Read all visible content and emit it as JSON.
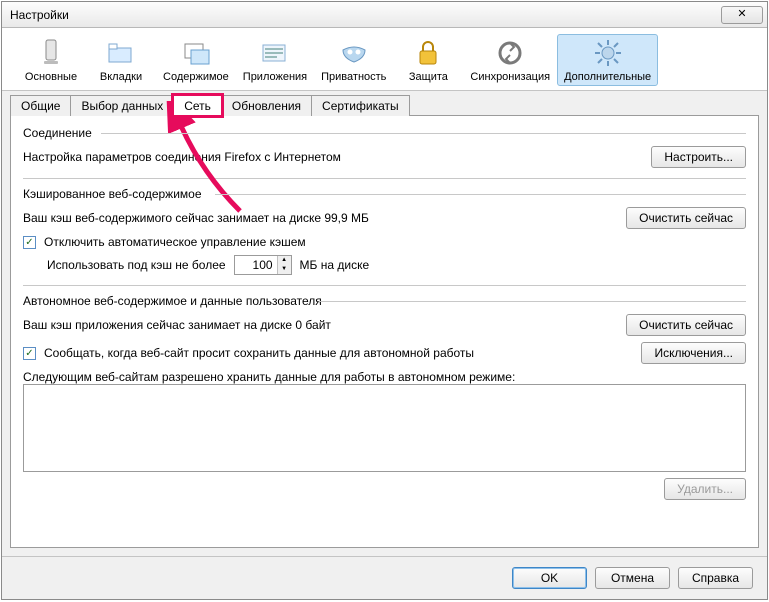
{
  "window": {
    "title": "Настройки"
  },
  "toolbar": [
    {
      "label": "Основные",
      "name": "general-icon"
    },
    {
      "label": "Вкладки",
      "name": "tabs-icon"
    },
    {
      "label": "Содержимое",
      "name": "content-icon"
    },
    {
      "label": "Приложения",
      "name": "applications-icon"
    },
    {
      "label": "Приватность",
      "name": "privacy-icon"
    },
    {
      "label": "Защита",
      "name": "security-icon"
    },
    {
      "label": "Синхронизация",
      "name": "sync-icon"
    },
    {
      "label": "Дополнительные",
      "name": "advanced-icon",
      "active": true
    }
  ],
  "tabs": [
    {
      "label": "Общие"
    },
    {
      "label": "Выбор данных"
    },
    {
      "label": "Сеть",
      "active": true,
      "highlight": true
    },
    {
      "label": "Обновления"
    },
    {
      "label": "Сертификаты"
    }
  ],
  "connection": {
    "title": "Соединение",
    "desc": "Настройка параметров соединения Firefox с Интернетом",
    "settings_btn": "Настроить..."
  },
  "cache": {
    "title": "Кэшированное веб-содержимое",
    "status": "Ваш кэш веб-содержимого сейчас занимает на диске 99,9 МБ",
    "clear_btn": "Очистить сейчас",
    "override_chk": "Отключить автоматическое управление кэшем",
    "override_checked": true,
    "limit_label_pre": "Использовать под кэш не более",
    "limit_value": "100",
    "limit_label_post": "МБ на диске"
  },
  "offline": {
    "title": "Автономное веб-содержимое и данные пользователя",
    "status": "Ваш кэш приложения сейчас занимает на диске 0 байт",
    "clear_btn": "Очистить сейчас",
    "notify_chk": "Сообщать, когда веб-сайт просит сохранить данные для автономной работы",
    "notify_checked": true,
    "exceptions_btn": "Исключения...",
    "list_label": "Следующим веб-сайтам разрешено хранить данные для работы в автономном режиме:",
    "remove_btn": "Удалить..."
  },
  "footer": {
    "ok": "OK",
    "cancel": "Отмена",
    "help": "Справка"
  }
}
